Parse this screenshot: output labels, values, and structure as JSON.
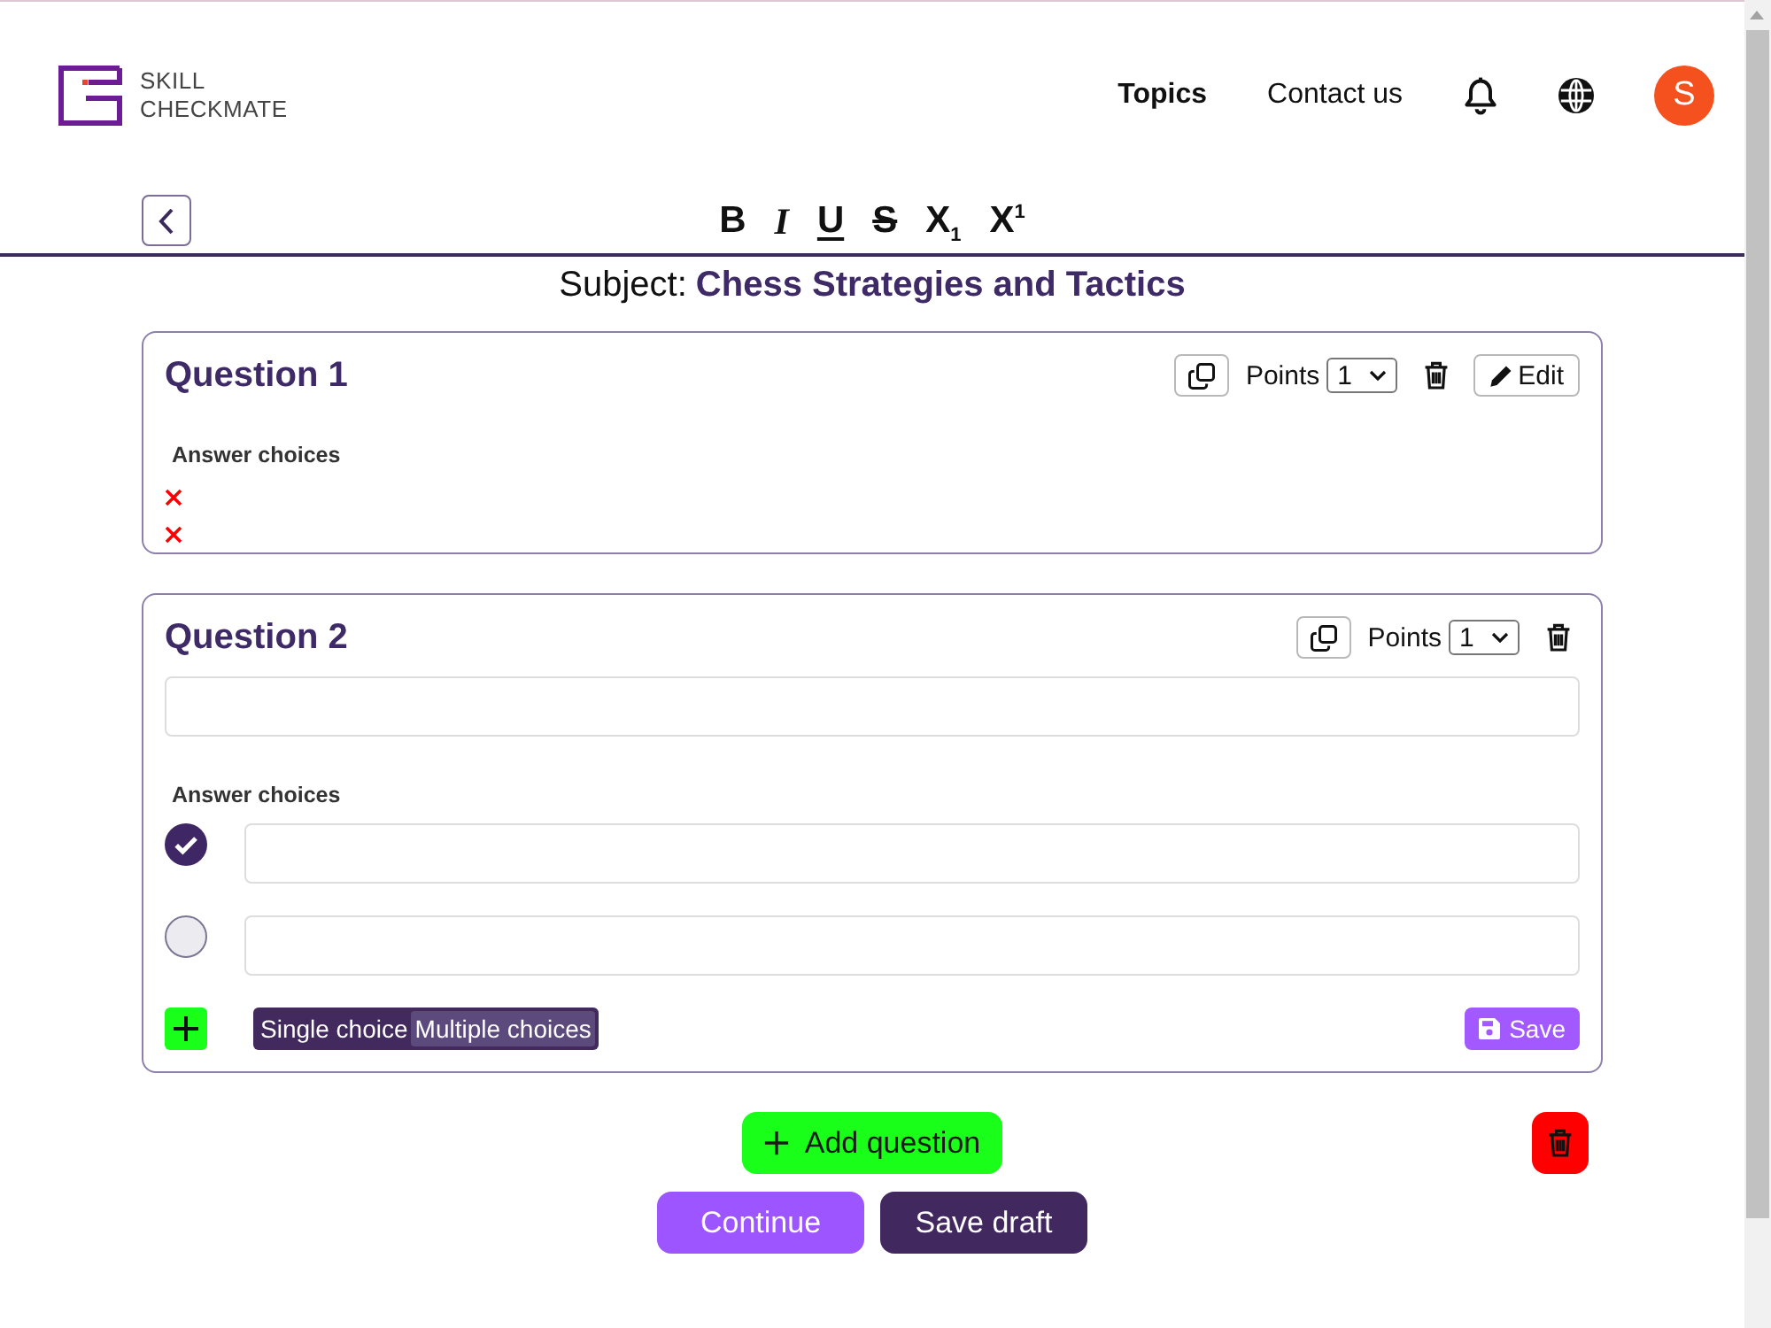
{
  "header": {
    "logo": {
      "lines": [
        "SKILL",
        "CHECKMATE"
      ]
    },
    "nav": [
      {
        "label": "Topics",
        "selected": true
      },
      {
        "label": "Contact us",
        "selected": false
      }
    ],
    "avatar": {
      "initial": "S"
    }
  },
  "format_toolbar": [
    {
      "kind": "bold",
      "label": "B"
    },
    {
      "kind": "italic",
      "label": "I"
    },
    {
      "kind": "underline",
      "label": "U"
    },
    {
      "kind": "strike",
      "label": "S"
    },
    {
      "kind": "subscript",
      "label": "X$_{1}$"
    },
    {
      "kind": "superscript",
      "label": "X$^{1}$"
    }
  ],
  "subject": {
    "label": "Subject:",
    "value": "Chess Strategies and Tactics"
  },
  "questions": [
    {
      "kind": "preview",
      "title": "Question 1",
      "points_label": "Points",
      "points": "1",
      "edit_button": "Edit",
      "answers_heading": "Answer choices",
      "choices": [
        {
          "correct": false
        },
        {
          "correct": false
        }
      ]
    },
    {
      "kind": "editor",
      "title": "Question 2",
      "points_label": "Points",
      "points": "1",
      "answers_heading": "Answer choices",
      "choices": [
        {
          "correct": true
        },
        {
          "correct": false
        }
      ],
      "choice_types": [
        {
          "label": "Single choice",
          "selected": false
        },
        {
          "label": "Multiple choices",
          "selected": true
        }
      ],
      "save_button": "Save"
    }
  ],
  "actions": {
    "add_question": "Add question",
    "continue": "Continue",
    "save_draft": "Save draft"
  }
}
